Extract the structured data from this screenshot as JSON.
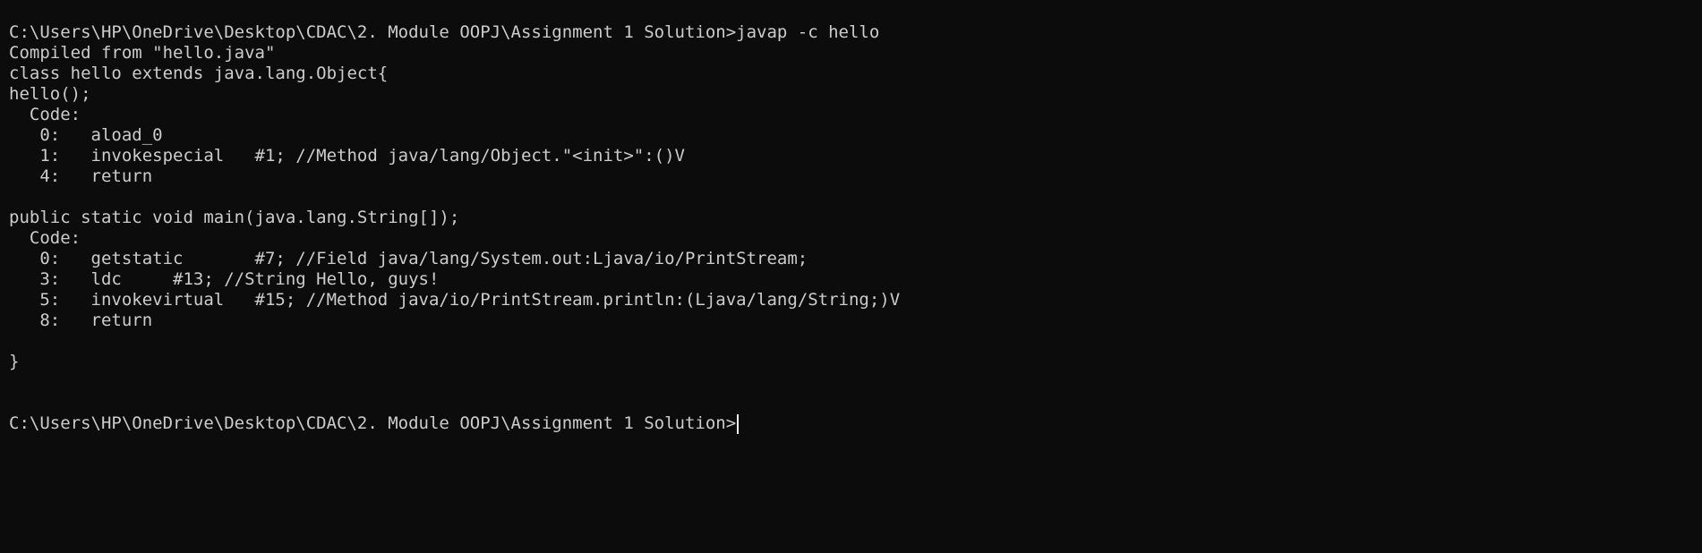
{
  "terminal": {
    "background_color": "#0c0c0c",
    "text_color": "#cccccc",
    "lines": [
      "C:\\Users\\HP\\OneDrive\\Desktop\\CDAC\\2. Module OOPJ\\Assignment 1 Solution>javap -c hello",
      "Compiled from \"hello.java\"",
      "class hello extends java.lang.Object{",
      "hello();",
      "  Code:",
      "   0:   aload_0",
      "   1:   invokespecial   #1; //Method java/lang/Object.\"<init>\":()V",
      "   4:   return",
      "",
      "public static void main(java.lang.String[]);",
      "  Code:",
      "   0:   getstatic       #7; //Field java/lang/System.out:Ljava/io/PrintStream;",
      "   3:   ldc     #13; //String Hello, guys!",
      "   5:   invokevirtual   #15; //Method java/io/PrintStream.println:(Ljava/lang/String;)V",
      "   8:   return",
      "",
      "}",
      "",
      "",
      "C:\\Users\\HP\\OneDrive\\Desktop\\CDAC\\2. Module OOPJ\\Assignment 1 Solution>"
    ]
  }
}
